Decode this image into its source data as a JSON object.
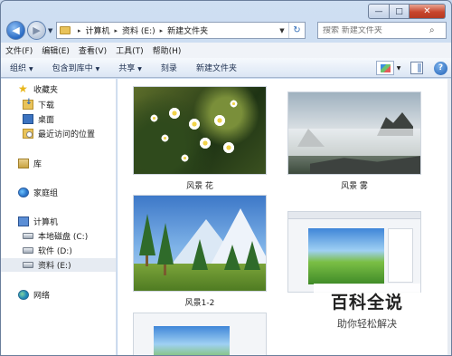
{
  "window": {
    "minimize_glyph": "—",
    "maximize_glyph": "□",
    "close_glyph": "✕"
  },
  "address": {
    "crumbs": [
      "计算机",
      "资料 (E:)",
      "新建文件夹"
    ],
    "separator": "▸"
  },
  "search": {
    "placeholder": "搜索 新建文件夹"
  },
  "menu": [
    "文件(F)",
    "编辑(E)",
    "查看(V)",
    "工具(T)",
    "帮助(H)"
  ],
  "toolbar": {
    "organize": "组织",
    "include_in_library": "包含到库中",
    "share": "共享",
    "burn": "刻录",
    "new_folder": "新建文件夹"
  },
  "nav": {
    "favorites": "收藏夹",
    "downloads": "下载",
    "desktop": "桌面",
    "recent": "最近访问的位置",
    "libraries": "库",
    "homegroup": "家庭组",
    "computer": "计算机",
    "drive_c": "本地磁盘 (C:)",
    "drive_d": "软件 (D:)",
    "drive_e": "资料 (E:)",
    "network": "网络"
  },
  "files": [
    {
      "name": "风景 花"
    },
    {
      "name": "风景 雾"
    },
    {
      "name": "风景1-2"
    },
    {
      "name": ""
    },
    {
      "name": ""
    }
  ],
  "watermark": {
    "main": "百科全说",
    "sub": "助你轻松解决"
  },
  "colors": {
    "accent": "#2a6bc4",
    "selected_nav": "#e6ebf2"
  }
}
